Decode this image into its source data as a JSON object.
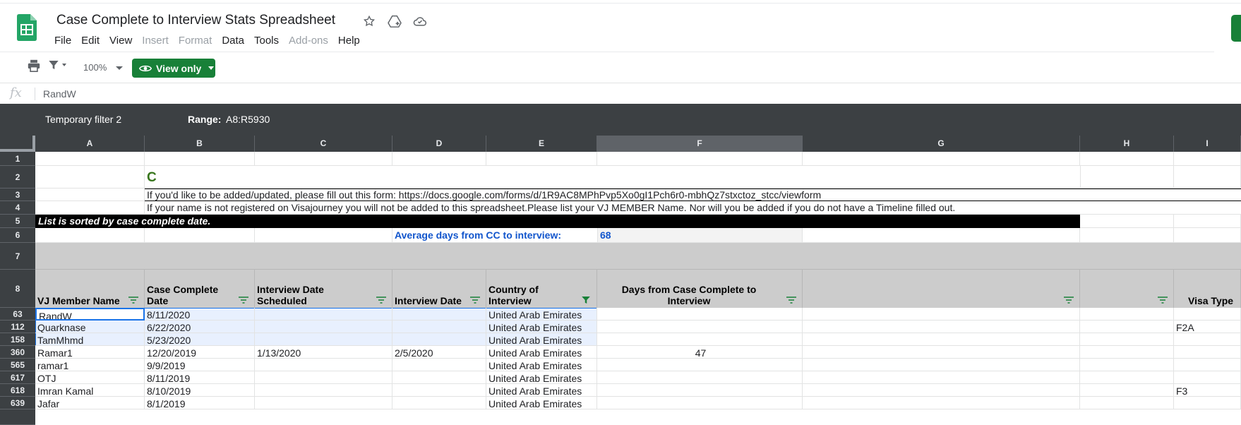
{
  "doc": {
    "title": "Case Complete to Interview Stats Spreadsheet",
    "menu": [
      {
        "label": "File",
        "enabled": true
      },
      {
        "label": "Edit",
        "enabled": true
      },
      {
        "label": "View",
        "enabled": true
      },
      {
        "label": "Insert",
        "enabled": false
      },
      {
        "label": "Format",
        "enabled": false
      },
      {
        "label": "Data",
        "enabled": true
      },
      {
        "label": "Tools",
        "enabled": true
      },
      {
        "label": "Add-ons",
        "enabled": false
      },
      {
        "label": "Help",
        "enabled": true
      }
    ]
  },
  "toolbar": {
    "zoom": "100%",
    "view_only_label": "View only"
  },
  "formula_bar": {
    "fx": "fx",
    "value": "RandW"
  },
  "filter_bar": {
    "name": "Temporary filter 2",
    "range_label": "Range:",
    "range_value": "A8:R5930"
  },
  "columns": [
    "A",
    "B",
    "C",
    "D",
    "E",
    "F",
    "G",
    "H",
    "I"
  ],
  "sheet": {
    "row_numbers": [
      "1",
      "2",
      "3",
      "4",
      "5",
      "6",
      "7",
      "8"
    ],
    "c_letter": "C",
    "form_note": "If you'd like to be added/updated, please fill out this form: https://docs.google.com/forms/d/1R9AC8MPhPvp5Xo0gI1Pch6r0-mbhQz7stxctoz_stcc/viewform",
    "registration_note": "If your name is not registered on Visajourney you will not be added to this spreadsheet.Please list your VJ MEMBER Name. Nor will you be added if you do not have a Timeline filled out.",
    "sort_note": "List is sorted by case complete date.",
    "avg_label": "Average days from CC to interview:",
    "avg_value": "68",
    "headers": {
      "a": "VJ Member Name",
      "b1": "Case Complete",
      "b2": "Date",
      "c1": "Interview Date",
      "c2": "Scheduled",
      "d": "Interview Date",
      "e1": "Country of",
      "e2": "Interview",
      "f1": "Days from Case Complete to",
      "f2": "Interview",
      "i": "Visa Type"
    }
  },
  "data_rows": [
    {
      "row": "63",
      "name": "RandW",
      "cc_date": "8/11/2020",
      "scheduled": "",
      "interview": "",
      "country": "United Arab Emirates",
      "days": "",
      "visa": ""
    },
    {
      "row": "112",
      "name": "Quarknase",
      "cc_date": "6/22/2020",
      "scheduled": "",
      "interview": "",
      "country": "United Arab Emirates",
      "days": "",
      "visa": "F2A"
    },
    {
      "row": "158",
      "name": "TamMhmd",
      "cc_date": "5/23/2020",
      "scheduled": "",
      "interview": "",
      "country": "United Arab Emirates",
      "days": "",
      "visa": ""
    },
    {
      "row": "360",
      "name": "Ramar1",
      "cc_date": "12/20/2019",
      "scheduled": "1/13/2020",
      "interview": "2/5/2020",
      "country": "United Arab Emirates",
      "days": "47",
      "visa": ""
    },
    {
      "row": "565",
      "name": "ramar1",
      "cc_date": "9/9/2019",
      "scheduled": "",
      "interview": "",
      "country": "United Arab Emirates",
      "days": "",
      "visa": ""
    },
    {
      "row": "617",
      "name": "OTJ",
      "cc_date": "8/11/2019",
      "scheduled": "",
      "interview": "",
      "country": "United Arab Emirates",
      "days": "",
      "visa": ""
    },
    {
      "row": "618",
      "name": "Imran Kamal",
      "cc_date": "8/10/2019",
      "scheduled": "",
      "interview": "",
      "country": "United Arab Emirates",
      "days": "",
      "visa": "F3"
    },
    {
      "row": "639",
      "name": "Jafar",
      "cc_date": "8/1/2019",
      "scheduled": "",
      "interview": "",
      "country": "United Arab Emirates",
      "days": "",
      "visa": ""
    }
  ]
}
